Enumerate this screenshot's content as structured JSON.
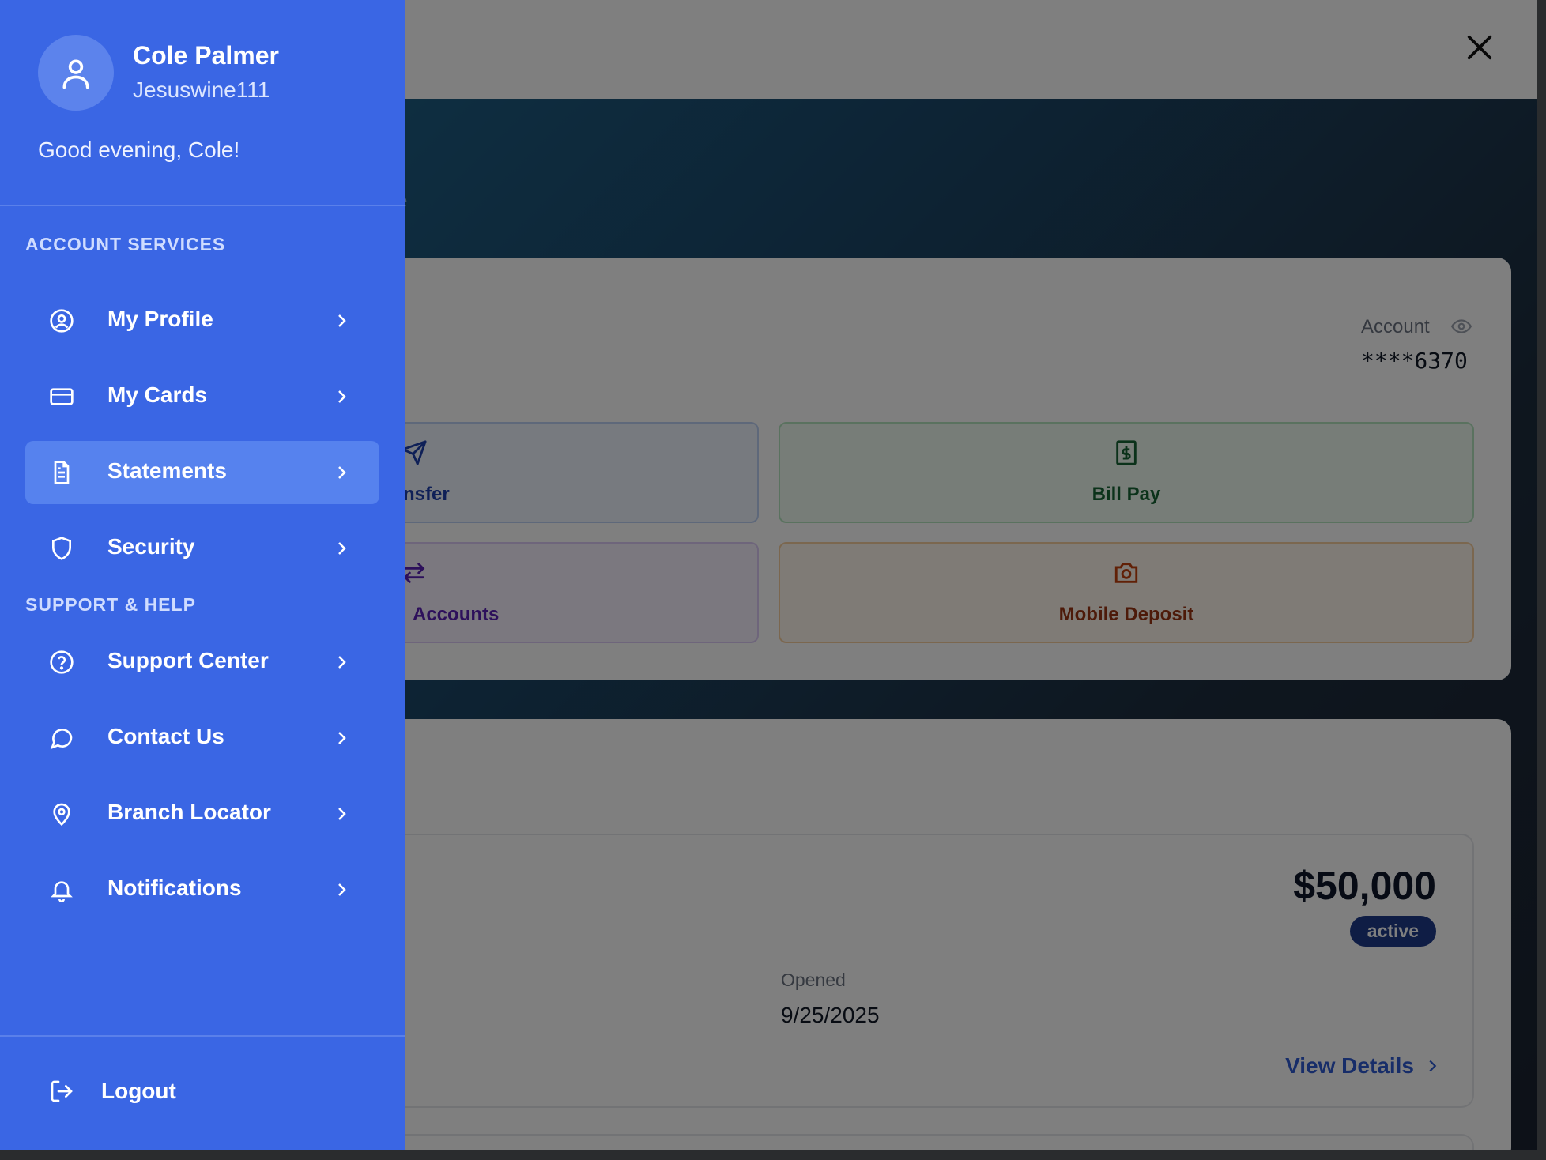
{
  "drawer": {
    "user": {
      "name": "Cole Palmer",
      "handle": "Jesuswine111"
    },
    "greeting": "Good evening, Cole!",
    "sections": [
      {
        "title": "ACCOUNT SERVICES"
      },
      {
        "title": "SUPPORT & HELP"
      }
    ],
    "items": [
      {
        "label": "My Profile",
        "icon": "user-circle-icon",
        "active": false
      },
      {
        "label": "My Cards",
        "icon": "credit-card-icon",
        "active": false
      },
      {
        "label": "Statements",
        "icon": "document-icon",
        "active": true
      },
      {
        "label": "Security",
        "icon": "shield-icon",
        "active": false
      },
      {
        "label": "Support Center",
        "icon": "help-circle-icon",
        "active": false
      },
      {
        "label": "Contact Us",
        "icon": "chat-bubble-icon",
        "active": false
      },
      {
        "label": "Branch Locator",
        "icon": "map-pin-icon",
        "active": false
      },
      {
        "label": "Notifications",
        "icon": "bell-icon",
        "active": false
      }
    ],
    "logout": {
      "label": "Logout",
      "icon": "logout-icon"
    }
  },
  "background": {
    "hero_subtitle_fragment": "e",
    "account": {
      "label": "Account",
      "number": "****6370"
    },
    "quick_actions": [
      {
        "label": "nsfer",
        "color": "#1e40af"
      },
      {
        "label": "Bill Pay",
        "color": "#166534"
      },
      {
        "label": "Accounts",
        "color": "#5b21b6"
      },
      {
        "label": "Mobile Deposit",
        "color": "#9a3412"
      }
    ],
    "account_card": {
      "balance": "$50,000",
      "status": "active",
      "opened_label": "Opened",
      "opened_date": "9/25/2025",
      "view_details": "View Details"
    }
  },
  "colors": {
    "drawer": "#3a66e4",
    "drawer_active_item": "#5682ee",
    "overlay": "rgba(0,0,0,0.5)"
  }
}
